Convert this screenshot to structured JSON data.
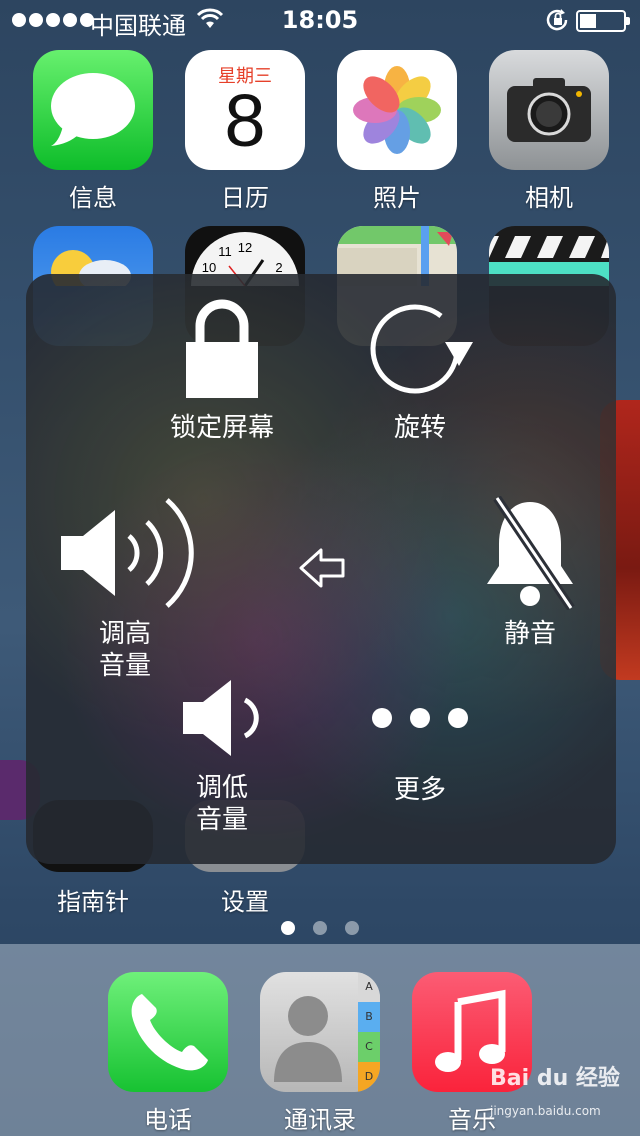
{
  "status_bar": {
    "carrier": "中国联通",
    "time": "18:05",
    "signal_dots": 5
  },
  "home_row1": [
    {
      "label": "信息",
      "icon": "messages-icon"
    },
    {
      "label": "日历",
      "icon": "calendar-icon",
      "day": "星期三",
      "date": "8"
    },
    {
      "label": "照片",
      "icon": "photos-icon"
    },
    {
      "label": "相机",
      "icon": "camera-icon"
    }
  ],
  "home_row2_visible": [
    {
      "icon": "weather-icon"
    },
    {
      "icon": "clock-icon",
      "numbers": [
        "12",
        "11",
        "10",
        "2"
      ]
    },
    {
      "icon": "maps-icon"
    },
    {
      "icon": "videos-icon"
    }
  ],
  "home_row3": [
    {
      "label": "指南针",
      "icon": "compass-icon"
    },
    {
      "label": "设置",
      "icon": "settings-icon"
    }
  ],
  "assistive_panel": {
    "lock_screen": "锁定屏幕",
    "rotate": "旋转",
    "volume_up_line1": "调高",
    "volume_up_line2": "音量",
    "mute": "静音",
    "volume_down_line1": "调低",
    "volume_down_line2": "音量",
    "more": "更多"
  },
  "page_indicator": {
    "pages": 3,
    "current": 1
  },
  "dock": [
    {
      "label": "电话",
      "icon": "phone-icon"
    },
    {
      "label": "通讯录",
      "icon": "contacts-icon",
      "tabs": [
        "A",
        "B",
        "C",
        "D"
      ]
    },
    {
      "label": "音乐",
      "icon": "music-icon"
    }
  ],
  "watermark": {
    "brand": "Bai du 经验",
    "url": "jingyan.baidu.com"
  }
}
